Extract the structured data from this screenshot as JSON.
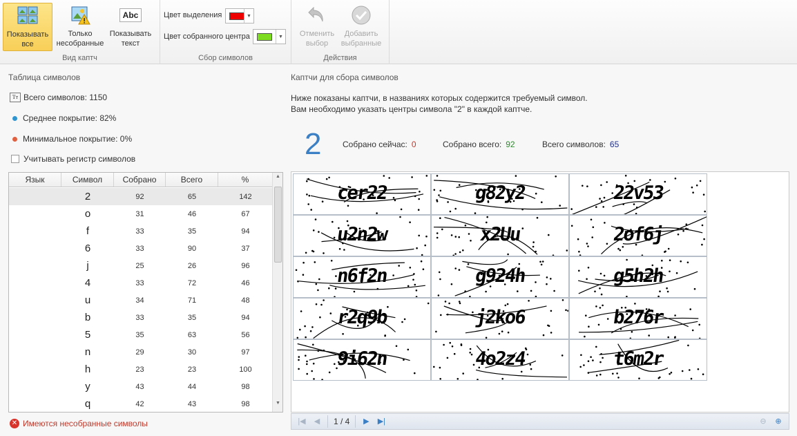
{
  "ribbon": {
    "groups": [
      {
        "caption": "Вид каптч"
      },
      {
        "caption": "Сбор символов"
      },
      {
        "caption": "Действия"
      }
    ],
    "show_all": "Показывать\nвсе",
    "show_all_l1": "Показывать",
    "show_all_l2": "все",
    "only_uncollected_l1": "Только",
    "only_uncollected_l2": "несобранные",
    "show_text_l1": "Показывать",
    "show_text_l2": "текст",
    "abc": "Abc",
    "selection_color_label": "Цвет выделения",
    "selection_color": "#ee0000",
    "center_color_label": "Цвет собранного центра",
    "center_color": "#7ddc1f",
    "undo_l1": "Отменить",
    "undo_l2": "выбор",
    "add_l1": "Добавить",
    "add_l2": "выбранные"
  },
  "left": {
    "title": "Таблица символов",
    "total_symbols": "Всего символов: 1150",
    "avg_coverage": "Среднее покрытие: 82%",
    "min_coverage": "Минимальное покрытие: 0%",
    "case_sensitive": "Учитывать регистр символов",
    "tt_icon": "Tт",
    "avg_dot_color": "#2f95d1",
    "min_dot_color": "#e06040",
    "columns": [
      "Язык",
      "Символ",
      "Собрано",
      "Всего",
      "%"
    ],
    "rows": [
      {
        "lang": "",
        "symbol": "2",
        "collected": "92",
        "total": "65",
        "pct": "142"
      },
      {
        "lang": "",
        "symbol": "o",
        "collected": "31",
        "total": "46",
        "pct": "67"
      },
      {
        "lang": "",
        "symbol": "f",
        "collected": "33",
        "total": "35",
        "pct": "94"
      },
      {
        "lang": "",
        "symbol": "6",
        "collected": "33",
        "total": "90",
        "pct": "37"
      },
      {
        "lang": "",
        "symbol": "j",
        "collected": "25",
        "total": "26",
        "pct": "96"
      },
      {
        "lang": "",
        "symbol": "4",
        "collected": "33",
        "total": "72",
        "pct": "46"
      },
      {
        "lang": "",
        "symbol": "u",
        "collected": "34",
        "total": "71",
        "pct": "48"
      },
      {
        "lang": "",
        "symbol": "b",
        "collected": "33",
        "total": "35",
        "pct": "94"
      },
      {
        "lang": "",
        "symbol": "5",
        "collected": "35",
        "total": "63",
        "pct": "56"
      },
      {
        "lang": "",
        "symbol": "n",
        "collected": "29",
        "total": "30",
        "pct": "97"
      },
      {
        "lang": "",
        "symbol": "h",
        "collected": "23",
        "total": "23",
        "pct": "100"
      },
      {
        "lang": "",
        "symbol": "y",
        "collected": "43",
        "total": "44",
        "pct": "98"
      },
      {
        "lang": "",
        "symbol": "q",
        "collected": "42",
        "total": "43",
        "pct": "98"
      }
    ],
    "warning": "Имеются несобранные символы"
  },
  "right": {
    "title": "Каптчи для сбора символов",
    "desc_line1": "Ниже показаны каптчи, в названиях которых содержится требуемый символ.",
    "desc_line2": "Вам необходимо указать центры символа \"2\" в каждой каптче.",
    "symbol": "2",
    "collected_now_label": "Собрано сейчас:",
    "collected_now": "0",
    "collected_now_color": "#c0392b",
    "collected_total_label": "Собрано всего:",
    "collected_total": "92",
    "collected_total_color": "#2e8b2e",
    "total_label": "Всего символов:",
    "total": "65",
    "total_color": "#1f2f8f",
    "captchas": [
      "cer22",
      "g82y2",
      "22v53",
      "u2n2w",
      "x2Uu",
      "2of6j",
      "n6f2n",
      "g924h",
      "g5h2h",
      "r2q9b",
      "j2ko6",
      "b276r",
      "9i62n",
      "4o2z4",
      "t6m2r"
    ],
    "pager": "1 / 4"
  }
}
